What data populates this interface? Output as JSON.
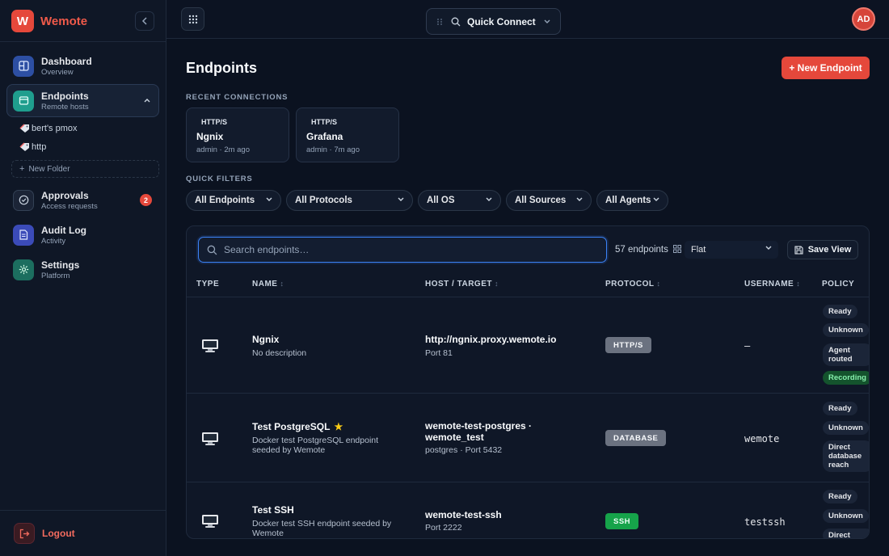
{
  "brand": {
    "logo_letter": "W",
    "name": "Wemote",
    "accent": "#e5483b"
  },
  "sidebar": {
    "collapse_icon": "chevron-left-icon",
    "nav": [
      {
        "label": "Dashboard",
        "sub": "Overview",
        "icon": "dashboard-icon"
      },
      {
        "label": "Endpoints",
        "sub": "Remote hosts",
        "icon": "endpoints-icon",
        "active": true,
        "expanded": true
      },
      {
        "label": "Approvals",
        "sub": "Access requests",
        "icon": "approvals-icon",
        "badge": "2"
      },
      {
        "label": "Audit Log",
        "sub": "Activity",
        "icon": "audit-log-icon"
      },
      {
        "label": "Settings",
        "sub": "Platform",
        "icon": "settings-icon"
      }
    ],
    "folders": [
      {
        "label": "bert's pmox",
        "icon": "tag-icon"
      },
      {
        "label": "http",
        "icon": "tag-icon"
      }
    ],
    "new_folder": "New Folder",
    "logout": "Logout"
  },
  "topbar": {
    "quick_connect": "Quick Connect",
    "avatar_initials": "AD"
  },
  "main": {
    "title": "Endpoints",
    "new_button": "+ New Endpoint",
    "recent_label": "RECENT CONNECTIONS",
    "recent": [
      {
        "protocol": "HTTP/S",
        "name": "Ngnix",
        "meta": "admin · 2m ago"
      },
      {
        "protocol": "HTTP/S",
        "name": "Grafana",
        "meta": "admin · 7m ago"
      }
    ],
    "filters_label": "QUICK FILTERS",
    "filters": [
      "All Endpoints",
      "All Protocols",
      "All OS",
      "All Sources",
      "All Agents"
    ]
  },
  "table": {
    "search_placeholder": "Search endpoints…",
    "count": "57 endpoints",
    "view": "Flat",
    "save_view": "Save View",
    "columns": [
      "TYPE",
      "NAME",
      "HOST / TARGET",
      "PROTOCOL",
      "USERNAME",
      "POLICY"
    ],
    "rows": [
      {
        "type_icon": "monitor-icon",
        "name": "Ngnix",
        "starred": false,
        "description": "No description",
        "host": "http://ngnix.proxy.wemote.io",
        "port": "Port 81",
        "protocol": "HTTP/S",
        "protocol_color": "#6b7280",
        "username": "—",
        "policy": [
          "Ready",
          "Unknown",
          "Agent routed",
          "Recording"
        ]
      },
      {
        "type_icon": "monitor-icon",
        "name": "Test PostgreSQL",
        "starred": true,
        "description": "Docker test PostgreSQL endpoint seeded by Wemote",
        "host": "wemote-test-postgres · wemote_test",
        "port": "postgres · Port 5432",
        "protocol": "DATABASE",
        "protocol_color": "#6b7280",
        "username": "wemote",
        "policy": [
          "Ready",
          "Unknown",
          "Direct database reach"
        ]
      },
      {
        "type_icon": "monitor-icon",
        "name": "Test SSH",
        "starred": false,
        "description": "Docker test SSH endpoint seeded by Wemote",
        "host": "wemote-test-ssh",
        "port": "Port 2222",
        "protocol": "SSH",
        "protocol_color": "#16a34a",
        "username": "testssh",
        "policy": [
          "Ready",
          "Unknown",
          "Direct"
        ]
      }
    ]
  }
}
